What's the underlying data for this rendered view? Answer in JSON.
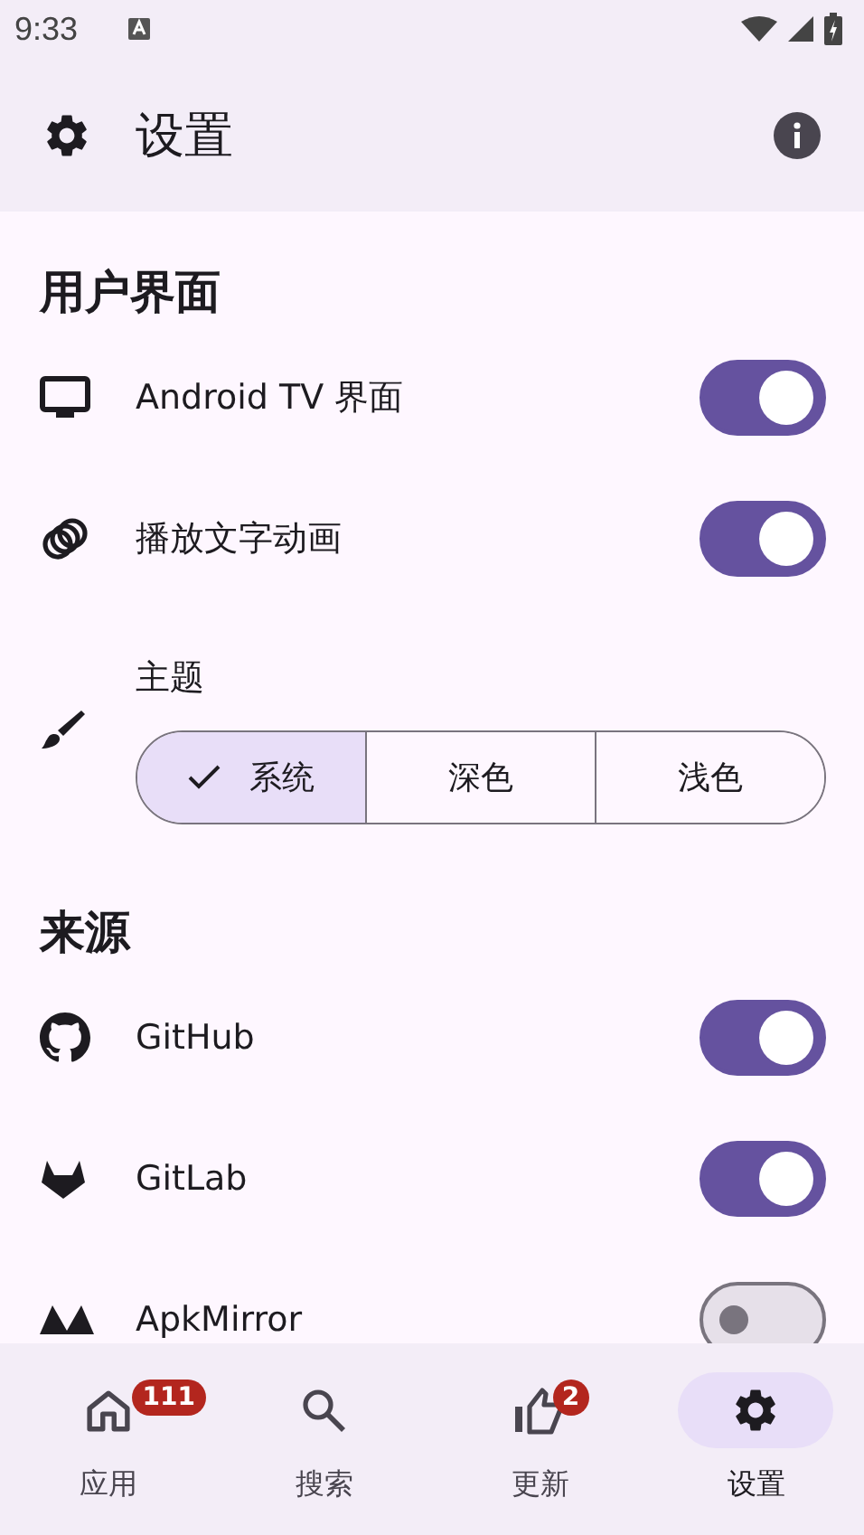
{
  "status_bar": {
    "time": "9:33"
  },
  "app_bar": {
    "title": "设置"
  },
  "sections": [
    {
      "title": "用户界面",
      "items": [
        {
          "kind": "switch",
          "label": "Android TV 界面",
          "on": true
        },
        {
          "kind": "switch",
          "label": "播放文字动画",
          "on": true
        },
        {
          "kind": "segmented",
          "label": "主题",
          "options": [
            {
              "label": "系统",
              "selected": true
            },
            {
              "label": "深色",
              "selected": false
            },
            {
              "label": "浅色",
              "selected": false
            }
          ]
        }
      ]
    },
    {
      "title": "来源",
      "items": [
        {
          "kind": "switch",
          "label": "GitHub",
          "on": true
        },
        {
          "kind": "switch",
          "label": "GitLab",
          "on": true
        },
        {
          "kind": "switch",
          "label": "ApkMirror",
          "on": false
        }
      ]
    }
  ],
  "nav": [
    {
      "label": "应用",
      "badge": "111",
      "selected": false
    },
    {
      "label": "搜索",
      "selected": false
    },
    {
      "label": "更新",
      "badge": "2",
      "selected": false
    },
    {
      "label": "设置",
      "selected": true
    }
  ]
}
